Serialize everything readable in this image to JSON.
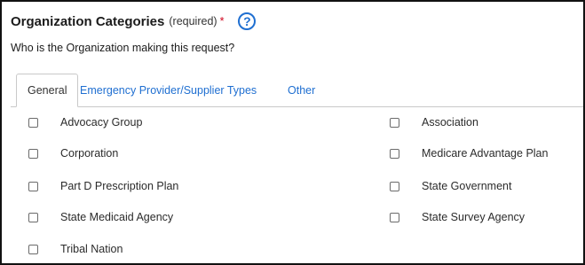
{
  "section": {
    "title": "Organization Categories",
    "required_label": "(required)",
    "required_marker": "*",
    "help_icon": "?",
    "question": "Who is the Organization making this request?"
  },
  "tabs": [
    {
      "label": "General",
      "active": true
    },
    {
      "label": "Emergency Provider/Supplier Types",
      "active": false
    },
    {
      "label": "Other",
      "active": false
    }
  ],
  "options": {
    "left": [
      "Advocacy Group",
      "Corporation",
      "Part D Prescription Plan",
      "State Medicaid Agency",
      "Tribal Nation"
    ],
    "right": [
      "Association",
      "Medicare Advantage Plan",
      "State Government",
      "State Survey Agency"
    ]
  },
  "colors": {
    "accent": "#1f6fd1",
    "required": "#d0021b",
    "border": "#111111"
  }
}
